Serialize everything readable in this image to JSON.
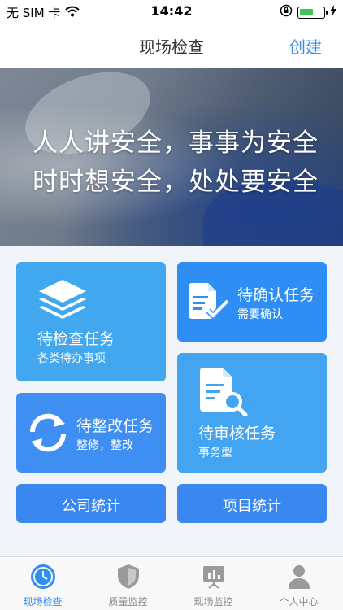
{
  "status_bar": {
    "carrier": "无 SIM 卡",
    "time": "14:42",
    "icons": [
      "wifi-icon",
      "rotation-lock-icon",
      "battery-icon",
      "charging-icon"
    ]
  },
  "nav": {
    "title": "现场检查",
    "create_label": "创建"
  },
  "banner": {
    "line1": "人人讲安全，事事为安全",
    "line2": "时时想安全，处处要安全"
  },
  "cards": {
    "pending_check": {
      "title": "待检查任务",
      "subtitle": "各类待办事项",
      "icon": "layers-icon"
    },
    "pending_confirm": {
      "title": "待确认任务",
      "subtitle": "需要确认",
      "icon": "document-check-icon"
    },
    "pending_fix": {
      "title": "待整改任务",
      "subtitle": "整修，整改",
      "icon": "refresh-icon"
    },
    "pending_review": {
      "title": "待审核任务",
      "subtitle": "事务型",
      "icon": "document-search-icon"
    }
  },
  "buttons": {
    "company_stats": "公司统计",
    "project_stats": "项目统计"
  },
  "tabs": [
    {
      "label": "现场检查",
      "icon": "clock-icon",
      "active": true
    },
    {
      "label": "质量监控",
      "icon": "shield-icon",
      "active": false
    },
    {
      "label": "现场监控",
      "icon": "presentation-board-icon",
      "active": false
    },
    {
      "label": "个人中心",
      "icon": "user-icon",
      "active": false
    }
  ],
  "colors": {
    "accent": "#2f8ef4",
    "card_light": "#41a8f0",
    "tab_active": "#2f8ef4",
    "tab_inactive": "#8a8a8a"
  }
}
